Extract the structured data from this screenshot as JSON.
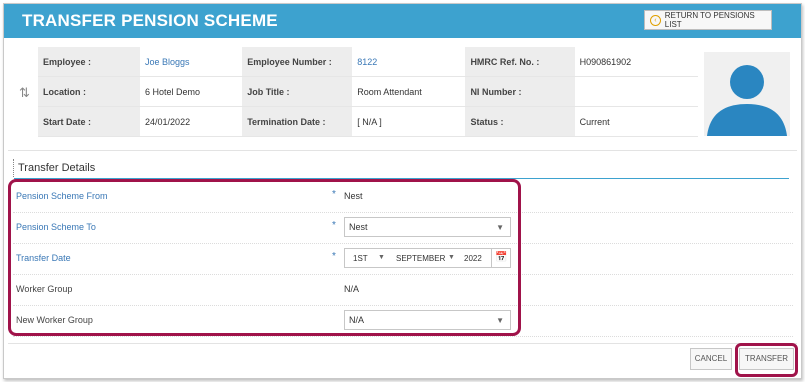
{
  "header": {
    "title": "TRANSFER PENSION SCHEME",
    "return_label": "RETURN TO PENSIONS LIST"
  },
  "employee": {
    "rows": [
      [
        {
          "label": "Employee :"
        },
        {
          "value": "Joe Bloggs",
          "link": true
        },
        {
          "label": "Employee Number :"
        },
        {
          "value": "8122",
          "link": true
        },
        {
          "label": "HMRC Ref. No. :"
        },
        {
          "value": "H090861902"
        }
      ],
      [
        {
          "label": "Location :"
        },
        {
          "value": "6 Hotel Demo"
        },
        {
          "label": "Job Title :"
        },
        {
          "value": "Room Attendant"
        },
        {
          "label": "NI Number :"
        },
        {
          "value": ""
        }
      ],
      [
        {
          "label": "Start Date :"
        },
        {
          "value": "24/01/2022"
        },
        {
          "label": "Termination Date :"
        },
        {
          "value": "[ N/A ]"
        },
        {
          "label": "Status :"
        },
        {
          "value": "Current"
        }
      ]
    ]
  },
  "details": {
    "title": "Transfer Details",
    "pension_from": {
      "label": "Pension Scheme From",
      "value": "Nest"
    },
    "pension_to": {
      "label": "Pension Scheme To",
      "value": "Nest"
    },
    "transfer_date": {
      "label": "Transfer Date",
      "day": "1ST",
      "month": "SEPTEMBER",
      "year": "2022"
    },
    "worker_group": {
      "label": "Worker Group",
      "value": "N/A"
    },
    "new_worker_group": {
      "label": "New Worker Group",
      "value": "N/A"
    }
  },
  "footer": {
    "cancel_label": "CANCEL",
    "transfer_label": "TRANSFER"
  },
  "colors": {
    "header": "#3da2cf",
    "highlight": "#a0134a",
    "link": "#3a78b6",
    "avatar": "#2a86c1"
  }
}
